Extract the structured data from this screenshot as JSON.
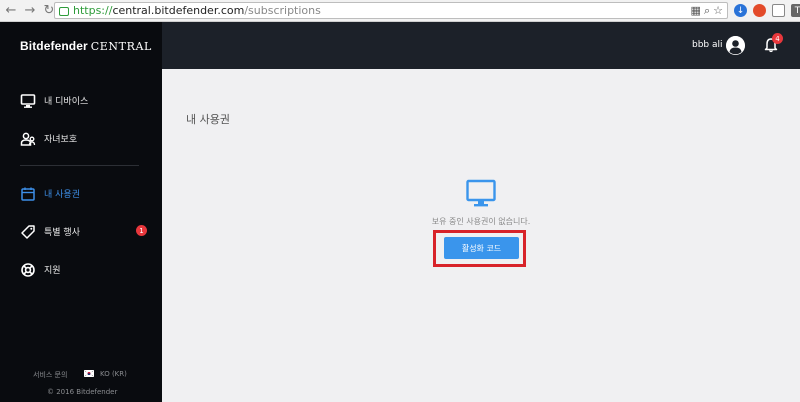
{
  "browser": {
    "url_scheme": "https://",
    "url_host": "central.bitdefender.com",
    "url_path": "/subscriptions"
  },
  "brand": {
    "name_bold": "Bitdefender",
    "name_suffix": "CENTRAL"
  },
  "sidebar": {
    "items": [
      {
        "label": "내 디바이스",
        "icon": "monitor-icon"
      },
      {
        "label": "자녀보호",
        "icon": "parental-control-icon"
      },
      {
        "label": "내 사용권",
        "icon": "calendar-icon",
        "active": true
      },
      {
        "label": "특별 행사",
        "icon": "tag-icon",
        "badge": "1"
      },
      {
        "label": "지원",
        "icon": "lifebuoy-icon"
      }
    ],
    "footer": {
      "support": "서비스 문의",
      "language": "KO (KR)",
      "copyright": "© 2016 Bitdefender"
    }
  },
  "header": {
    "user_name": "bbb ali",
    "notification_count": "4"
  },
  "main": {
    "title": "내 사용권",
    "empty_message": "보유 중인 사용권이 없습니다.",
    "activate_button": "활성화 코드"
  },
  "colors": {
    "sidebar_bg": "#090b0f",
    "topbar_bg": "#1c2129",
    "accent": "#3a95ec",
    "badge": "#e8373c",
    "highlight": "#d8232a"
  }
}
